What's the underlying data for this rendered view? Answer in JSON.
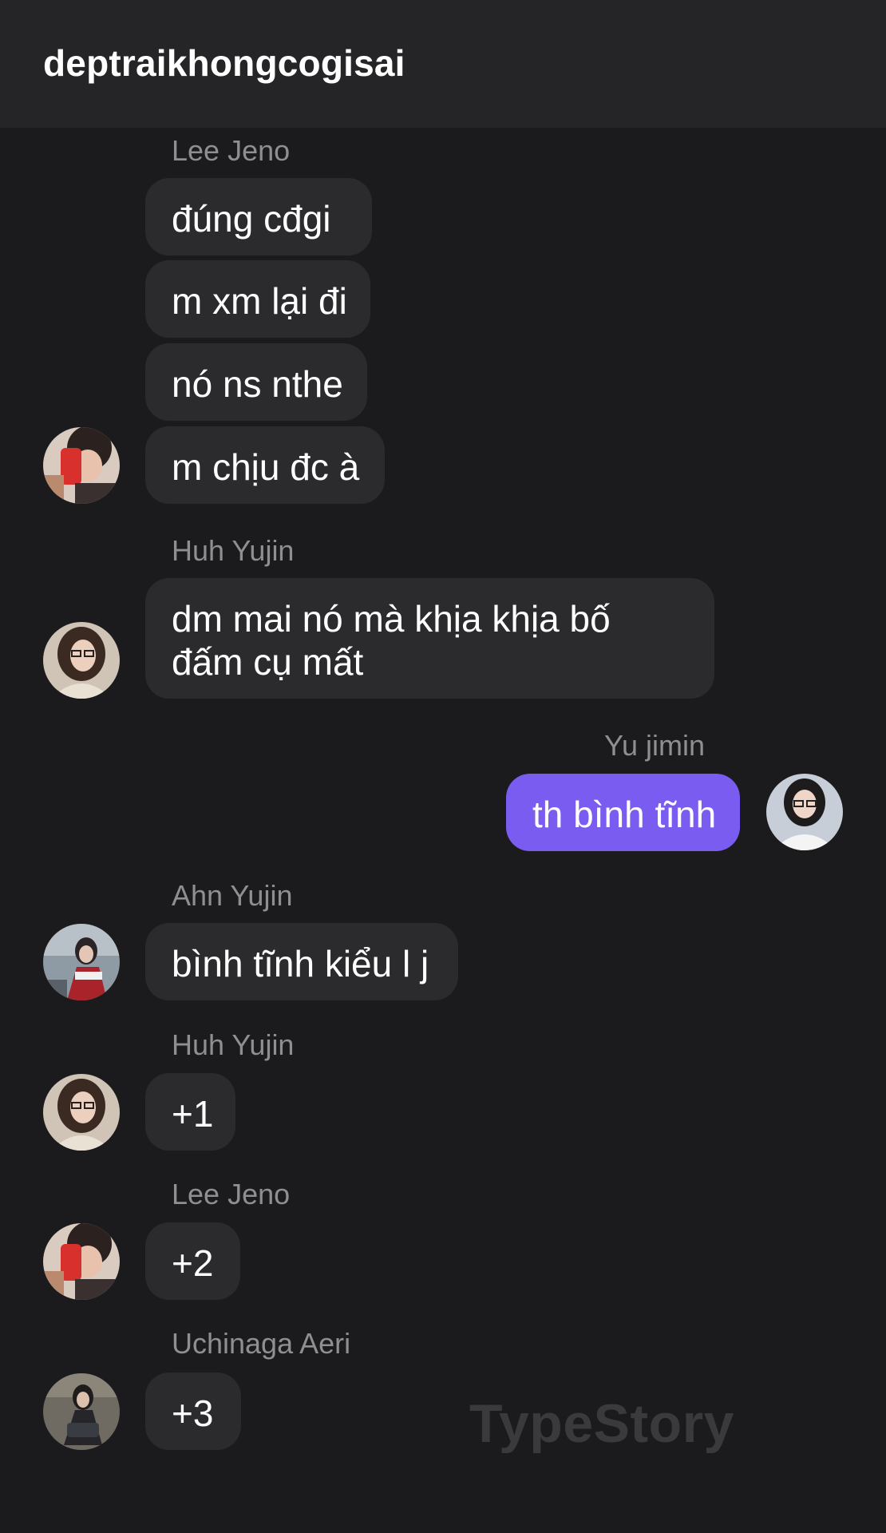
{
  "header": {
    "title": "deptraikhongcogisai"
  },
  "messages": [
    {
      "sender": "Lee Jeno",
      "texts": [
        "đúng cđgi",
        "m xm lại đi",
        "nó ns nthe",
        "m chịu đc à"
      ]
    },
    {
      "sender": "Huh Yujin",
      "texts": [
        "dm mai nó mà khịa khịa bố đấm cụ mất"
      ]
    },
    {
      "sender": "Yu jimin",
      "texts": [
        "th bình tĩnh"
      ],
      "mine": true
    },
    {
      "sender": "Ahn Yujin",
      "texts": [
        "bình tĩnh kiểu l j"
      ]
    },
    {
      "sender": "Huh Yujin",
      "texts": [
        "+1"
      ]
    },
    {
      "sender": "Lee Jeno",
      "texts": [
        "+2"
      ]
    },
    {
      "sender": "Uchinaga Aeri",
      "texts": [
        "+3"
      ]
    }
  ],
  "watermark": "TypeStory",
  "colors": {
    "background": "#1b1b1d",
    "header": "#252527",
    "bubble": "#2b2b2e",
    "my_bubble": "#7a5cf0",
    "sender_name": "#8e8e93"
  }
}
